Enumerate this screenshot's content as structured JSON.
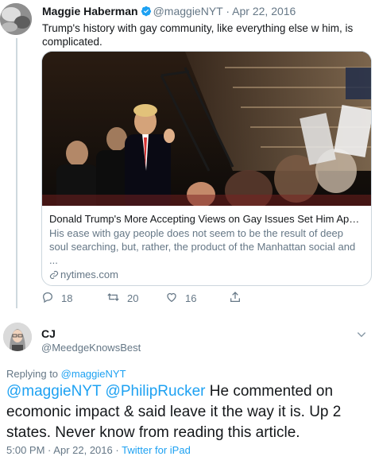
{
  "parent_tweet": {
    "author_name": "Maggie Haberman",
    "handle": "@maggieNYT",
    "separator": "·",
    "date": "Apr 22, 2016",
    "text": "Trump's history with gay community, like everything else w him, is complicated.",
    "card": {
      "title": "Donald Trump's More Accepting Views on Gay Issues Set Him Apart i...",
      "description": "His ease with gay people does not seem to be the result of deep soul searching, but, rather, the product of the Manhattan social and ...",
      "domain": "nytimes.com"
    },
    "actions": {
      "replies": "18",
      "retweets": "20",
      "likes": "16"
    }
  },
  "reply_tweet": {
    "author_name": "CJ",
    "handle": "@MeedgeKnowsBest",
    "replying_to_label": "Replying to",
    "replying_to_handle": "@maggieNYT",
    "mention_1": "@maggieNYT",
    "mention_2": "@PhilipRucker",
    "text": "He commented on ecomonic impact & said leave it the way it is. Up 2 states. Never know from reading this article.",
    "time": "5:00 PM",
    "separator": "·",
    "date": "Apr 22, 2016",
    "separator_2": "·",
    "source": "Twitter for iPad"
  },
  "colors": {
    "link": "#1da1f2",
    "muted": "#657786",
    "thread_line": "#cfd9de"
  },
  "icons": [
    "verified-badge-icon",
    "reply-icon",
    "retweet-icon",
    "like-icon",
    "share-icon",
    "link-icon",
    "chevron-down-icon"
  ]
}
